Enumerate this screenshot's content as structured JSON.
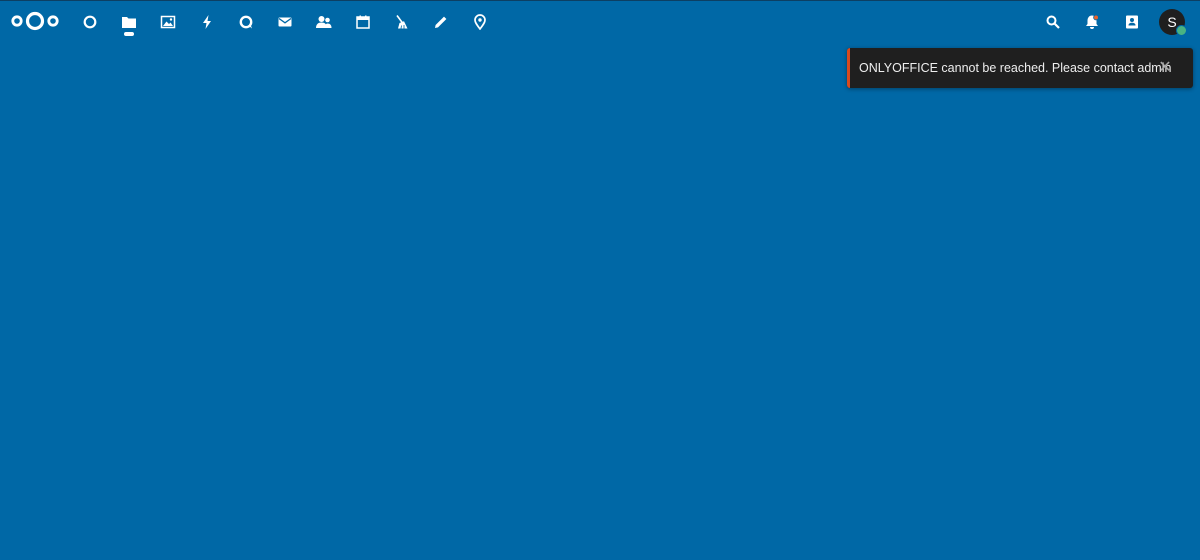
{
  "header": {
    "apps": [
      {
        "name": "dashboard",
        "icon": "dashboard-icon",
        "active": false
      },
      {
        "name": "files",
        "icon": "folder-icon",
        "active": true
      },
      {
        "name": "photos",
        "icon": "image-icon",
        "active": false
      },
      {
        "name": "activity",
        "icon": "lightning-icon",
        "active": false
      },
      {
        "name": "talk",
        "icon": "talk-icon",
        "active": false
      },
      {
        "name": "mail",
        "icon": "mail-icon",
        "active": false
      },
      {
        "name": "contacts",
        "icon": "contacts-icon",
        "active": false
      },
      {
        "name": "calendar",
        "icon": "calendar-icon",
        "active": false
      },
      {
        "name": "deck",
        "icon": "broom-icon",
        "active": false
      },
      {
        "name": "notes",
        "icon": "pencil-icon",
        "active": false
      },
      {
        "name": "maps",
        "icon": "map-pin-icon",
        "active": false
      }
    ],
    "right_icons": [
      "search-icon",
      "notifications-icon",
      "contacts-menu-icon"
    ],
    "user_initial": "S"
  },
  "toast": {
    "message": "ONLYOFFICE cannot be reached. Please contact admin",
    "close_symbol": "✕"
  },
  "colors": {
    "background": "#0068a6",
    "toast_bg": "#1f1f1f",
    "toast_accent": "#d84a1f",
    "status_online": "#49b382"
  }
}
